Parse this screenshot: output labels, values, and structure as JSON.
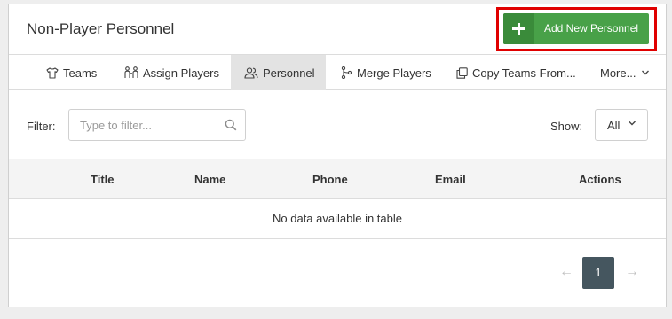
{
  "header": {
    "title": "Non-Player Personnel",
    "add_button_label": "Add New Personnel"
  },
  "tabs": [
    {
      "label": "Teams",
      "icon": "tshirt-icon"
    },
    {
      "label": "Assign Players",
      "icon": "players-icon"
    },
    {
      "label": "Personnel",
      "icon": "users-icon",
      "active": true
    },
    {
      "label": "Merge Players",
      "icon": "merge-icon"
    },
    {
      "label": "Copy Teams From...",
      "icon": "copy-icon"
    },
    {
      "label": "More...",
      "icon": "chevron-down-icon"
    }
  ],
  "filter": {
    "label": "Filter:",
    "placeholder": "Type to filter..."
  },
  "show": {
    "label": "Show:",
    "value": "All"
  },
  "table": {
    "columns": [
      "Title",
      "Name",
      "Phone",
      "Email",
      "Actions"
    ],
    "empty_message": "No data available in table"
  },
  "pagination": {
    "prev": "←",
    "current_page": "1",
    "next": "→"
  },
  "colors": {
    "primary_button": "#48a148",
    "highlight_border": "#e00000",
    "active_page": "#45565f"
  }
}
